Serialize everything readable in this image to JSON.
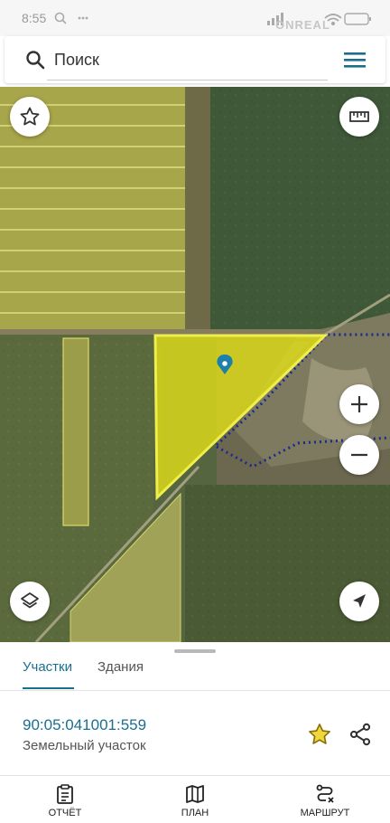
{
  "status_bar": {
    "time": "8:55",
    "left_icons": [
      "search-icon",
      "more-icon"
    ],
    "right_icons": [
      "signal-icon",
      "wifi-icon",
      "battery-icon"
    ],
    "battery": "91",
    "watermark": "ONREAL"
  },
  "search": {
    "placeholder": "Поиск",
    "icon": "search-icon",
    "menu_icon": "menu-icon"
  },
  "map": {
    "buttons": [
      "favorite-star-icon",
      "ruler-icon",
      "zoom-in-icon",
      "zoom-out-icon",
      "layers-icon",
      "my-location-icon"
    ],
    "selection_fill": "#e5e317",
    "boundary_color": "#1c2a8a",
    "pin_color": "#1e7fa8"
  },
  "sheet": {
    "tabs": [
      {
        "label": "Участки",
        "active": true
      },
      {
        "label": "Здания",
        "active": false
      }
    ],
    "parcel": {
      "cadastral_number": "90:05:041001:559",
      "type": "Земельный участок",
      "star_color": "#d9b51a"
    }
  },
  "bottom_nav": [
    {
      "label": "ОТЧЁТ",
      "icon": "report-icon"
    },
    {
      "label": "ПЛАН",
      "icon": "map-plan-icon"
    },
    {
      "label": "МАРШРУТ",
      "icon": "route-icon"
    }
  ],
  "colors": {
    "accent": "#1a6f8f"
  }
}
